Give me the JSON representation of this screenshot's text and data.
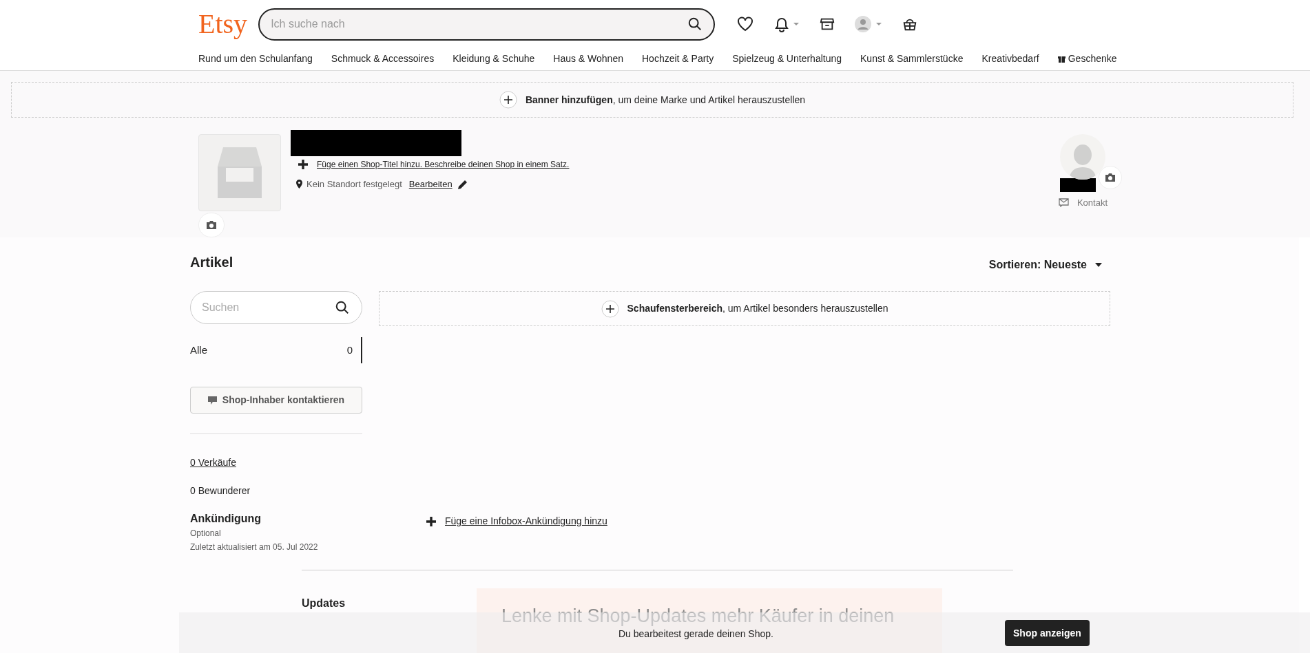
{
  "header": {
    "logo": "Etsy",
    "search": {
      "placeholder": "Ich suche nach"
    }
  },
  "nav": [
    {
      "label": "Rund um den Schulanfang",
      "kind": "text"
    },
    {
      "label": "Schmuck & Accessoires",
      "kind": "text"
    },
    {
      "label": "Kleidung & Schuhe",
      "kind": "text"
    },
    {
      "label": "Haus & Wohnen",
      "kind": "text"
    },
    {
      "label": "Hochzeit & Party",
      "kind": "text"
    },
    {
      "label": "Spielzeug & Unterhaltung",
      "kind": "text"
    },
    {
      "label": "Kunst & Sammlerstücke",
      "kind": "text"
    },
    {
      "label": "Kreativbedarf",
      "kind": "text"
    },
    {
      "label": "Geschenke",
      "kind": "gift"
    }
  ],
  "banner": {
    "text": "**Banner hinzufügen**, um deine Marke und Artikel herauszustellen"
  },
  "shop": {
    "title_link": "Füge einen Shop-Titel hinzu. Beschreibe deinen Shop in einem Satz.",
    "location": "Kein Standort festgelegt",
    "edit_link": "Bearbeiten",
    "contact": "Kontakt"
  },
  "items": {
    "title": "Artikel",
    "sort": "Sortieren: Neueste",
    "search": {
      "placeholder": "Suchen"
    },
    "showcase": "**Schaufensterbereich**, um Artikel besonders herauszustellen",
    "sections": [
      {
        "label": "Alle",
        "count": "0",
        "selected": true
      }
    ],
    "contact_button": "Shop-Inhaber kontaktieren"
  },
  "stats": {
    "sales": "0 Verkäufe",
    "admirers": "0 Bewunderer"
  },
  "announcement": {
    "title": "Ankündigung",
    "optional": "Optional",
    "updated": "Zuletzt aktualisiert am 05. Jul 2022",
    "add_link": "Füge eine Infobox-Ankündigung hinzu"
  },
  "updates": {
    "title": "Updates",
    "promo": "Lenke mit Shop-Updates mehr Käufer in deinen"
  },
  "edit_bar": {
    "text": "Du bearbeitest gerade deinen Shop.",
    "button": "Shop anzeigen"
  }
}
